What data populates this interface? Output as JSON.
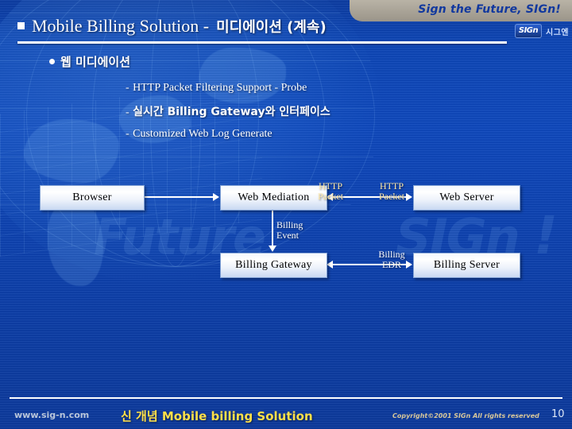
{
  "header": {
    "bullet_marker": "■",
    "title_en": "Mobile Billing Solution -",
    "title_kr": "미디에이션 (계속)",
    "tagline": "Sign the Future, SIGn!",
    "logo_text": "SIGn",
    "logo_kr": "시그엔"
  },
  "body": {
    "bullet": "웹 미디에이션",
    "subitems": [
      {
        "dash": "-",
        "text": "HTTP Packet Filtering Support -  Probe",
        "lang": "en"
      },
      {
        "dash": "-",
        "text": "실시간 Billing Gateway와 인터페이스",
        "lang": "kr"
      },
      {
        "dash": "-",
        "text": "Customized Web Log Generate",
        "lang": "en"
      }
    ]
  },
  "diagram": {
    "boxes": {
      "browser": "Browser",
      "web_mediation": "Web Mediation",
      "web_server": "Web Server",
      "billing_gateway": "Billing Gateway",
      "billing_server": "Billing Server"
    },
    "labels": {
      "http_packet_1_line1": "HTTP",
      "http_packet_1_line2": "Packet",
      "http_packet_2_line1": "HTTP",
      "http_packet_2_line2": "Packet",
      "billing_event_line1": "Billing",
      "billing_event_line2": "Event",
      "billing_edr_line1": "Billing",
      "billing_edr_line2": "EDR"
    },
    "label_colors": {
      "http_packet": "#ffe9a8",
      "billing_event": "#ffffff",
      "billing_edr": "#ffffff"
    }
  },
  "watermark": {
    "future": "Future",
    "sign": "SIGn",
    "bang": "!"
  },
  "footer": {
    "url": "www.sig-n.com",
    "title": "신 개념 Mobile billing Solution",
    "copyright": "Copyright©2001 SIGn All rights reserved",
    "page": "10"
  },
  "colors": {
    "background_blue": "#0b44b4",
    "accent_yellow": "#ffe04a",
    "tagline_tab": "#a8a296",
    "box_fill": "#ffffff"
  }
}
